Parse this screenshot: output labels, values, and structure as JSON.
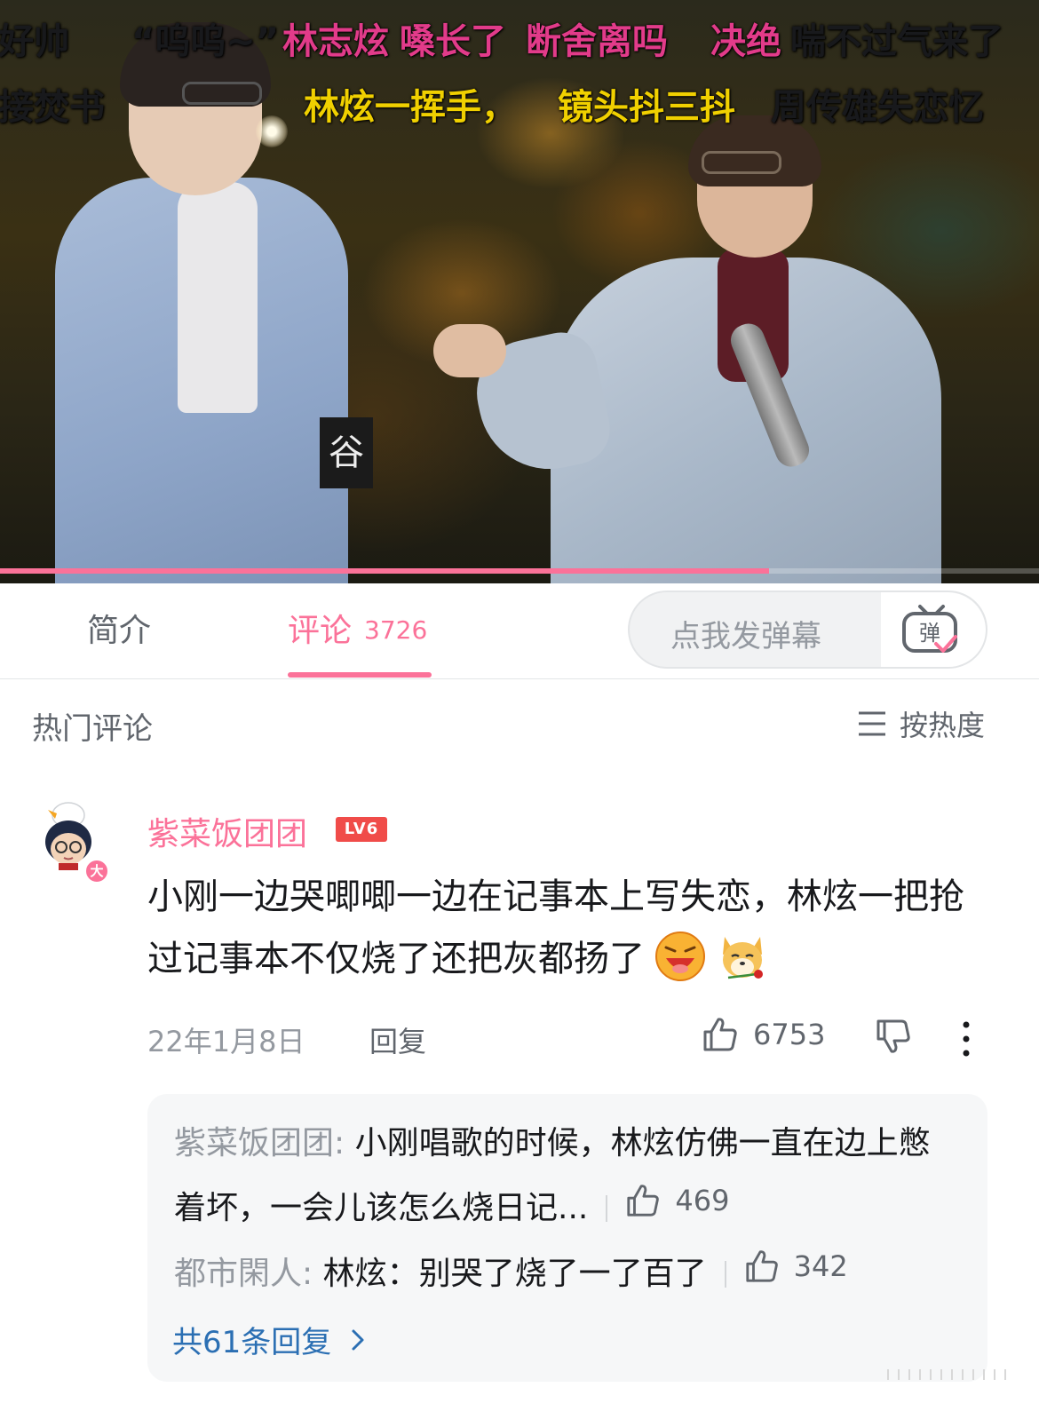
{
  "video": {
    "danmaku": [
      {
        "text": "好帅",
        "color": "#ffffff"
      },
      {
        "text": "“呜呜~”",
        "color": "#ffffff"
      },
      {
        "text": "林志炫",
        "color": "#e23b8a"
      },
      {
        "text": "嗓长了",
        "color": "#e23b8a"
      },
      {
        "text": "断舍离吗",
        "color": "#e23b8a"
      },
      {
        "text": "决绝",
        "color": "#e23b8a"
      },
      {
        "text": "喘不过气来了",
        "color": "#ffffff"
      },
      {
        "text": "接焚书",
        "color": "#ffffff"
      },
      {
        "text": "林炫一挥手，",
        "color": "#f0d000"
      },
      {
        "text": "镜头抖三抖",
        "color": "#f0d000"
      },
      {
        "text": "周传雄失恋忆",
        "color": "#ffffff"
      }
    ],
    "progress": 0.74
  },
  "tabs": {
    "intro_label": "简介",
    "comments_label": "评论",
    "comments_count": "3726",
    "danmaku_placeholder": "点我发弹幕",
    "danmaku_icon_char": "弹"
  },
  "hot": {
    "title": "热门评论",
    "sort_label": "按热度"
  },
  "comment": {
    "username": "紫菜饭团团",
    "level": "LV6",
    "avatar_badge": "大",
    "text": "小刚一边哭唧唧一边在记事本上写失恋，林炫一把抢过记事本不仅烧了还把灰都扬了",
    "date": "22年1月8日",
    "reply_label": "回复",
    "likes": "6753"
  },
  "replies": {
    "items": [
      {
        "user": "紫菜饭团团",
        "text": "小刚唱歌的时候，林炫仿佛一直在边上憋着坏，一会儿该怎么烧日记...",
        "likes": "469"
      },
      {
        "user": "都市閑人",
        "text": "林炫：别哭了烧了一了百了",
        "likes": "342"
      }
    ],
    "more_label": "共61条回复"
  }
}
